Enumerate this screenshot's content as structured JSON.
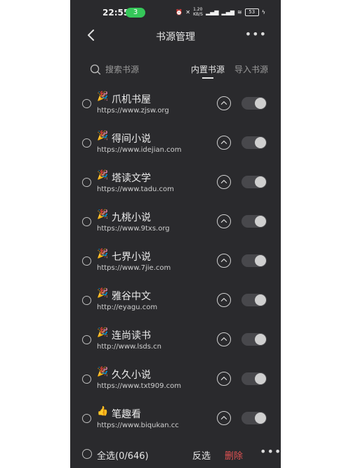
{
  "status_bar": {
    "time": "22:55",
    "badge": "3",
    "network": "1.20 KB/S",
    "battery": "53"
  },
  "header": {
    "title": "书源管理",
    "back_icon": "chevron-left-icon",
    "more_icon": "more-horizontal-icon"
  },
  "search": {
    "placeholder": "搜索书源"
  },
  "tabs": [
    {
      "label": "内置书源",
      "active": true
    },
    {
      "label": "导入书源",
      "active": false
    }
  ],
  "sources": [
    {
      "emoji": "🎉",
      "name": "爪机书屋",
      "url": "https://www.zjsw.org"
    },
    {
      "emoji": "🎉",
      "name": "得间小说",
      "url": "https://www.idejian.com"
    },
    {
      "emoji": "🎉",
      "name": "塔读文学",
      "url": "https://www.tadu.com"
    },
    {
      "emoji": "🎉",
      "name": "九桃小说",
      "url": "https://www.9txs.org"
    },
    {
      "emoji": "🎉",
      "name": "七界小说",
      "url": "https://www.7jie.com"
    },
    {
      "emoji": "🎉",
      "name": "雅谷中文",
      "url": "http://eyagu.com"
    },
    {
      "emoji": "🎉",
      "name": "连尚读书",
      "url": "http://www.lsds.cn"
    },
    {
      "emoji": "🎉",
      "name": "久久小说",
      "url": "https://www.txt909.com"
    },
    {
      "emoji": "👍",
      "name": "笔趣看",
      "url": "https://www.biqukan.cc"
    }
  ],
  "footer": {
    "select_all": "全选(0/646)",
    "invert": "反选",
    "delete": "删除"
  },
  "colors": {
    "background": "#2a2a2d",
    "status_badge": "#35c759",
    "delete": "#e05252"
  }
}
